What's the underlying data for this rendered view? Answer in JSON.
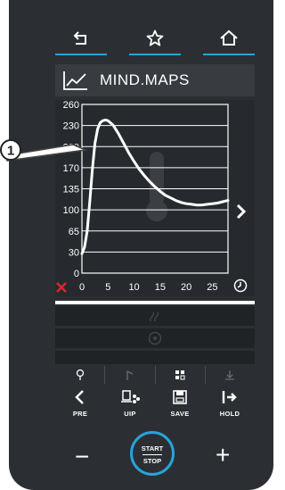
{
  "header": {
    "back_icon": "back-icon",
    "favorite_icon": "star-icon",
    "home_icon": "home-icon",
    "accent_color": "#29a3d8"
  },
  "title": {
    "icon": "line-chart-icon",
    "text": "MIND.MAPS"
  },
  "chart_data": {
    "type": "line",
    "y_ticks": [
      "260",
      "230",
      "200",
      "170",
      "135",
      "100",
      "65",
      "30",
      "0"
    ],
    "x_ticks": [
      "0",
      "5",
      "10",
      "15",
      "20",
      "25"
    ],
    "xlim": [
      0,
      28
    ],
    "ylim": [
      0,
      260
    ],
    "grid": true,
    "series": [
      {
        "x": [
          0,
          0.5,
          1,
          1.5,
          2,
          2.5,
          3,
          3.5,
          4,
          4.5,
          5,
          6,
          7,
          8,
          9,
          10,
          11,
          12,
          13,
          14,
          15,
          16,
          17,
          18,
          19,
          20,
          21,
          22,
          23,
          24,
          25,
          26,
          27,
          28
        ],
        "y": [
          30,
          40,
          65,
          110,
          160,
          200,
          222,
          232,
          235,
          236,
          235,
          228,
          215,
          200,
          185,
          172,
          160,
          150,
          141,
          133,
          126,
          120,
          116,
          112,
          109,
          107,
          106,
          105,
          105,
          106,
          107,
          108,
          110,
          112
        ]
      }
    ],
    "line_color": "#ffffff"
  },
  "callout": {
    "number": "1"
  },
  "status": {
    "cancel_icon": "close-icon",
    "timer_icon": "clock-icon"
  },
  "tabs": [
    "probe-icon",
    "sensor-icon",
    "fan-icon",
    "download-icon"
  ],
  "bottom_bar": {
    "pre_label": "PRE",
    "uip_label": "UIP",
    "save_label": "SAVE",
    "hold_label": "HOLD"
  },
  "controls": {
    "minus": "−",
    "plus": "+",
    "start_label": "START",
    "stop_label": "STOP"
  }
}
